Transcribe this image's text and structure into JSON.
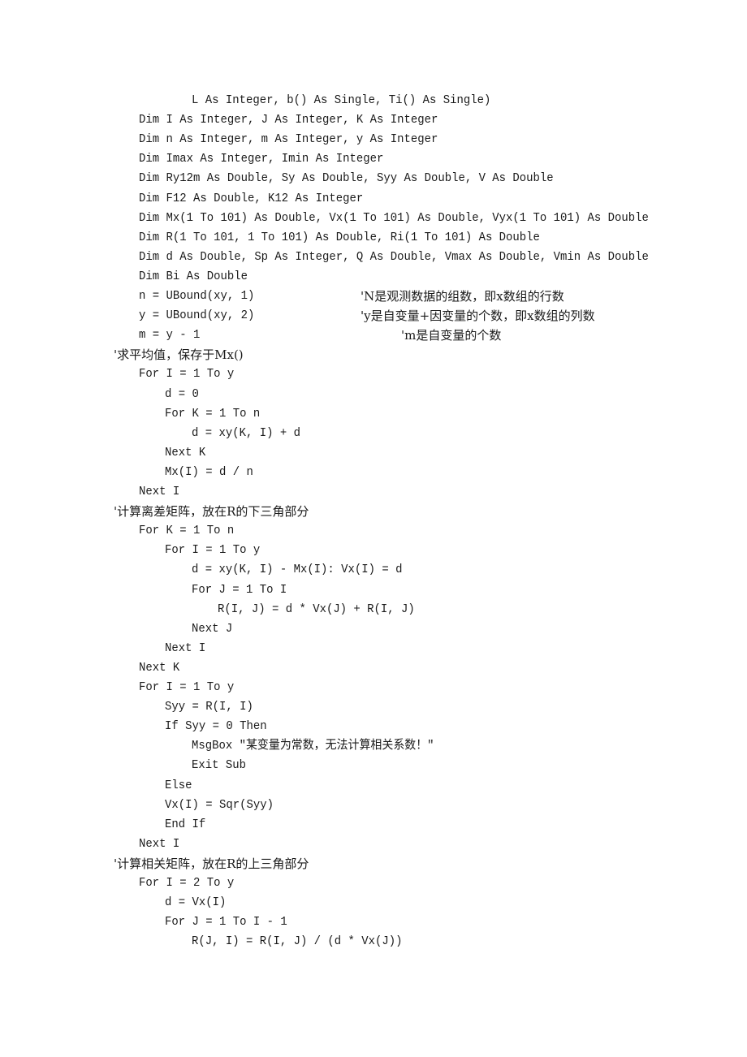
{
  "document": {
    "lines": [
      {
        "indent": 3,
        "text": "L As Integer, b() As Single, Ti() As Single)"
      },
      {
        "indent": 1,
        "text": "Dim I As Integer, J As Integer, K As Integer"
      },
      {
        "indent": 1,
        "text": "Dim n As Integer, m As Integer, y As Integer"
      },
      {
        "indent": 1,
        "text": "Dim Imax As Integer, Imin As Integer"
      },
      {
        "indent": 1,
        "text": "Dim Ry12m As Double, Sy As Double, Syy As Double, V As Double"
      },
      {
        "indent": 1,
        "text": "Dim F12 As Double, K12 As Integer"
      },
      {
        "indent": 1,
        "text": "Dim Mx(1 To 101) As Double, Vx(1 To 101) As Double, Vyx(1 To 101) As Double"
      },
      {
        "indent": 1,
        "text": "Dim R(1 To 101, 1 To 101) As Double, Ri(1 To 101) As Double"
      },
      {
        "indent": 1,
        "text": "Dim d As Double, Sp As Integer, Q As Double, Vmax As Double, Vmin As Double"
      },
      {
        "indent": 1,
        "text": "Dim Bi As Double"
      },
      {
        "indent": 1,
        "text": "n = UBound(xy, 1)",
        "comment": "'N是观测数据的组数，即x数组的行数",
        "comment_col": 0
      },
      {
        "indent": 1,
        "text": "y = UBound(xy, 2)",
        "comment": "'y是自变量+因变量的个数，即x数组的列数",
        "comment_col": 0
      },
      {
        "indent": 1,
        "text": "m = y - 1",
        "comment": "'m是自变量的个数",
        "comment_col": 1
      },
      {
        "indent": 0,
        "text": "'求平均值，保存于Mx()"
      },
      {
        "indent": 1,
        "text": "For I = 1 To y"
      },
      {
        "indent": 2,
        "text": "d = 0"
      },
      {
        "indent": 2,
        "text": "For K = 1 To n"
      },
      {
        "indent": 3,
        "text": "d = xy(K, I) + d"
      },
      {
        "indent": 2,
        "text": "Next K"
      },
      {
        "indent": 2,
        "text": "Mx(I) = d / n"
      },
      {
        "indent": 1,
        "text": "Next I"
      },
      {
        "indent": 0,
        "text": "'计算离差矩阵，放在R的下三角部分"
      },
      {
        "indent": 1,
        "text": "For K = 1 To n"
      },
      {
        "indent": 2,
        "text": "For I = 1 To y"
      },
      {
        "indent": 3,
        "text": "d = xy(K, I) - Mx(I): Vx(I) = d"
      },
      {
        "indent": 3,
        "text": "For J = 1 To I"
      },
      {
        "indent": 4,
        "text": "R(I, J) = d * Vx(J) + R(I, J)"
      },
      {
        "indent": 3,
        "text": "Next J"
      },
      {
        "indent": 2,
        "text": "Next I"
      },
      {
        "indent": 1,
        "text": "Next K"
      },
      {
        "indent": 1,
        "text": "For I = 1 To y"
      },
      {
        "indent": 2,
        "text": "Syy = R(I, I)"
      },
      {
        "indent": 2,
        "text": "If Syy = 0 Then"
      },
      {
        "indent": 3,
        "text": "MsgBox \"某变量为常数，无法计算相关系数！\""
      },
      {
        "indent": 3,
        "text": "Exit Sub"
      },
      {
        "indent": 2,
        "text": "Else"
      },
      {
        "indent": 2,
        "text": "Vx(I) = Sqr(Syy)"
      },
      {
        "indent": 2,
        "text": "End If"
      },
      {
        "indent": 1,
        "text": "Next I"
      },
      {
        "indent": 0,
        "text": "'计算相关矩阵，放在R的上三角部分"
      },
      {
        "indent": 1,
        "text": "For I = 2 To y"
      },
      {
        "indent": 2,
        "text": "d = Vx(I)"
      },
      {
        "indent": 2,
        "text": "For J = 1 To I - 1"
      },
      {
        "indent": 3,
        "text": "R(J, I) = R(I, J) / (d * Vx(J))"
      }
    ]
  }
}
